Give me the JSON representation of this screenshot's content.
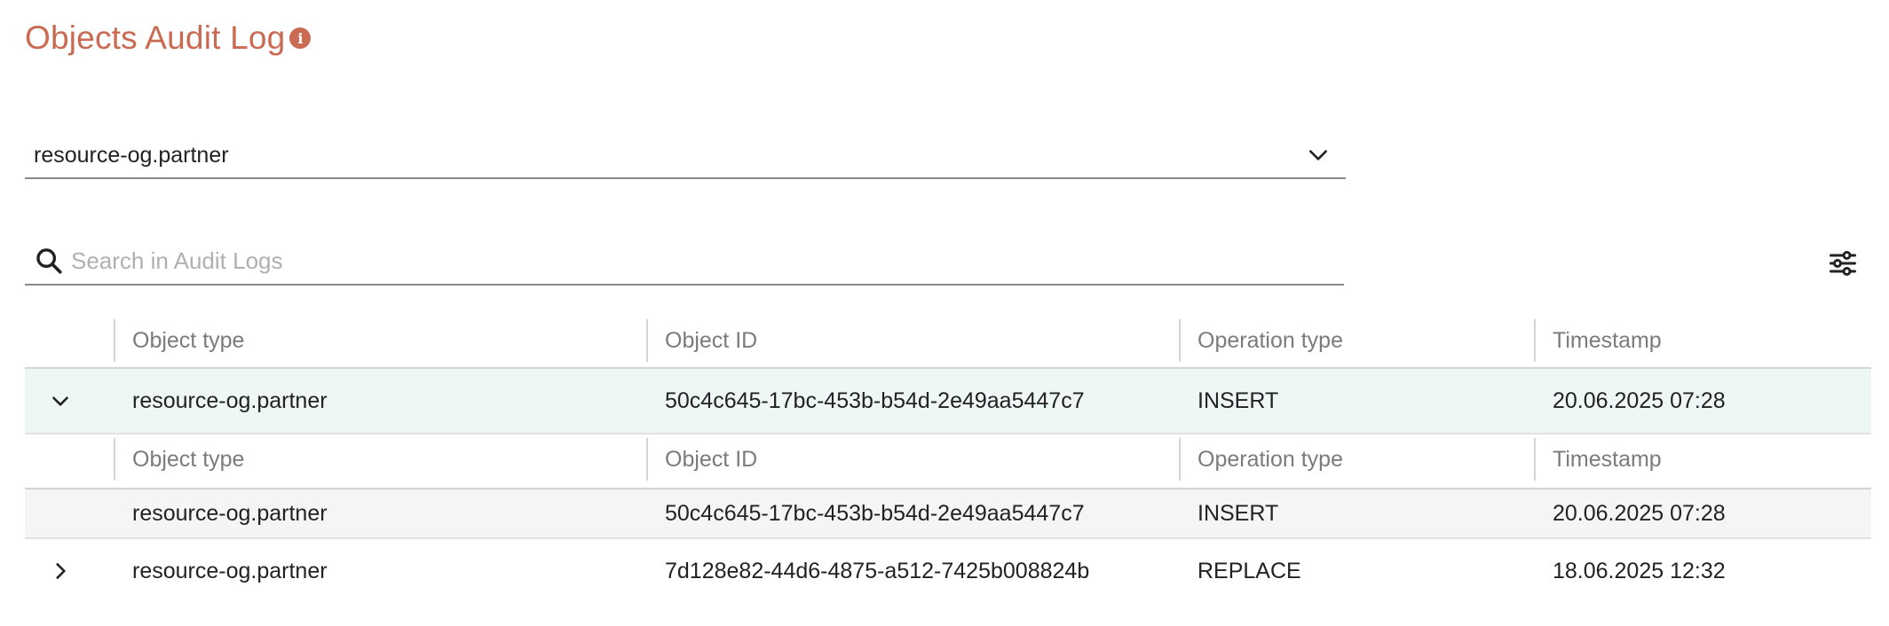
{
  "page": {
    "title": "Objects Audit Log",
    "info_icon": "info-icon",
    "accent_color": "#c96a52"
  },
  "object_select": {
    "value": "resource-og.partner",
    "icon": "chevron-down-icon"
  },
  "search": {
    "placeholder": "Search in Audit Logs",
    "value": "",
    "icon": "search-icon"
  },
  "filter_button": {
    "icon": "sliders-icon"
  },
  "table": {
    "columns": [
      "Object type",
      "Object ID",
      "Operation type",
      "Timestamp"
    ],
    "rows": [
      {
        "expanded": true,
        "object_type": "resource-og.partner",
        "object_id": "50c4c645-17bc-453b-b54d-2e49aa5447c7",
        "operation_type": "INSERT",
        "timestamp": "20.06.2025 07:28",
        "details": {
          "columns": [
            "Object type",
            "Object ID",
            "Operation type",
            "Timestamp"
          ],
          "rows": [
            {
              "object_type": "resource-og.partner",
              "object_id": "50c4c645-17bc-453b-b54d-2e49aa5447c7",
              "operation_type": "INSERT",
              "timestamp": "20.06.2025 07:28"
            }
          ]
        }
      },
      {
        "expanded": false,
        "object_type": "resource-og.partner",
        "object_id": "7d128e82-44d6-4875-a512-7425b008824b",
        "operation_type": "REPLACE",
        "timestamp": "18.06.2025 12:32"
      }
    ]
  }
}
